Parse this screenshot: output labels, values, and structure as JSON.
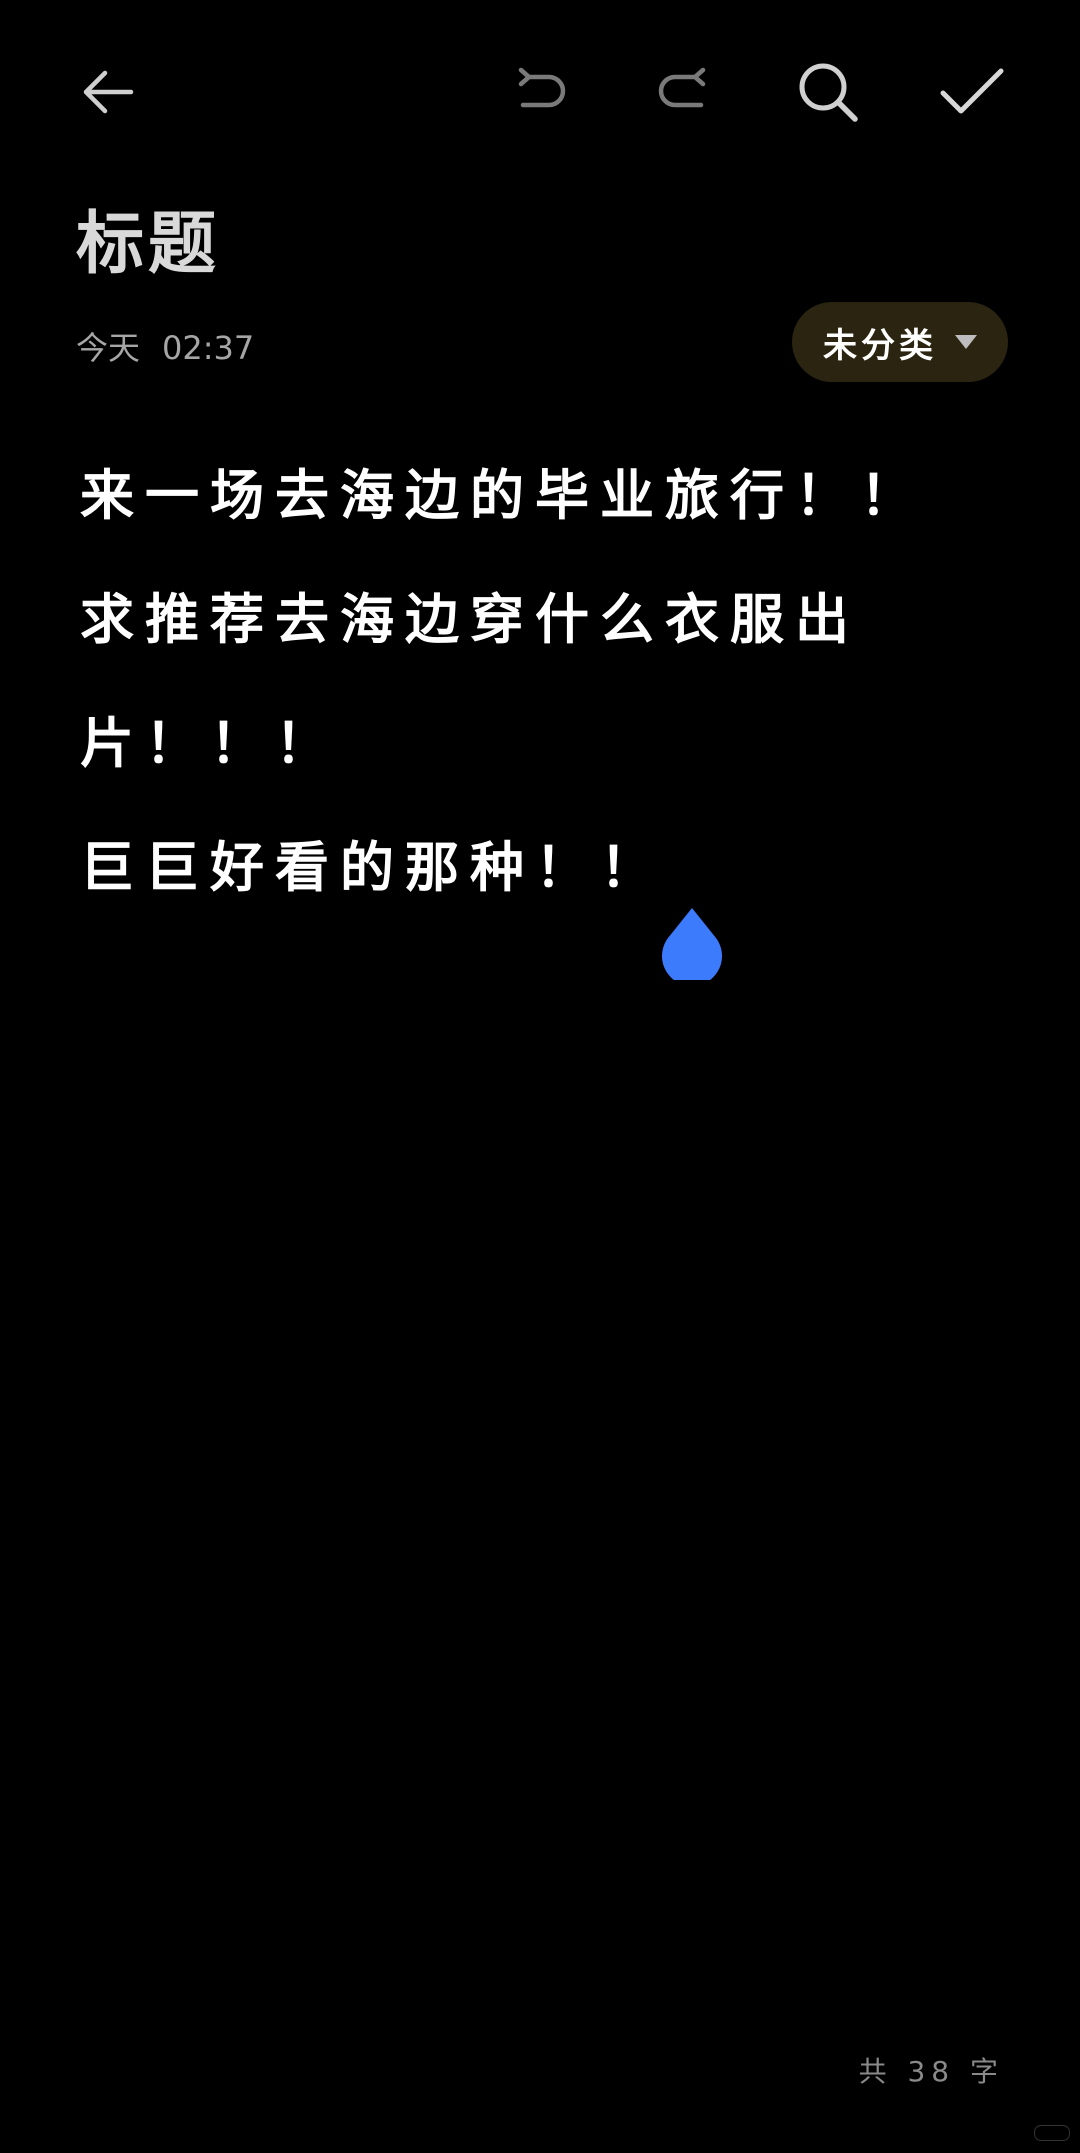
{
  "toolbar": {
    "back_icon": "arrow-left-icon",
    "undo_icon": "undo-icon",
    "redo_icon": "redo-icon",
    "search_icon": "search-icon",
    "confirm_icon": "check-icon"
  },
  "note": {
    "title": "标题",
    "date_label": "今天",
    "time": "02:37",
    "category": "未分类",
    "lines": [
      "来一场去海边的毕业旅行！！",
      "求推荐去海边穿什么衣服出片！！！",
      "巨巨好看的那种！！"
    ]
  },
  "footer": {
    "word_count": "共 38 字"
  },
  "colors": {
    "background": "#000000",
    "category_chip": "#2a2410",
    "cursor_handle": "#3d7bfd"
  }
}
